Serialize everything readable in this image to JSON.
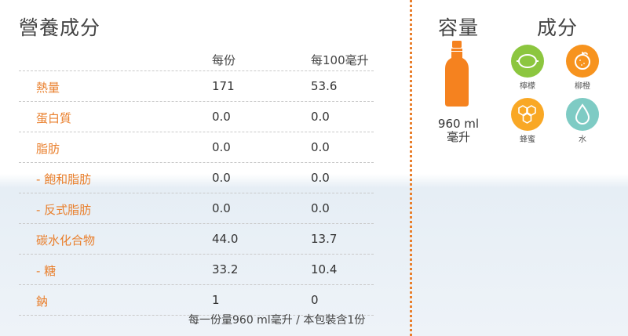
{
  "nutrition": {
    "title": "營養成分",
    "headers": [
      "每份",
      "每100毫升"
    ],
    "rows": [
      {
        "label": "熱量",
        "per_serving": "171",
        "per_100ml": "53.6"
      },
      {
        "label": "蛋白質",
        "per_serving": "0.0",
        "per_100ml": "0.0"
      },
      {
        "label": "脂肪",
        "per_serving": "0.0",
        "per_100ml": "0.0"
      },
      {
        "label": "- 飽和脂肪",
        "per_serving": "0.0",
        "per_100ml": "0.0"
      },
      {
        "label": "- 反式脂肪",
        "per_serving": "0.0",
        "per_100ml": "0.0"
      },
      {
        "label": "碳水化合物",
        "per_serving": "44.0",
        "per_100ml": "13.7"
      },
      {
        "label": "- 糖",
        "per_serving": "33.2",
        "per_100ml": "10.4"
      },
      {
        "label": "鈉",
        "per_serving": "1",
        "per_100ml": "0"
      }
    ],
    "footnote": "每一份量960 ml毫升 / 本包裝含1份"
  },
  "volume": {
    "title": "容量",
    "line1": "960 ml",
    "line2": "毫升"
  },
  "ingredients": {
    "title": "成分",
    "items": [
      {
        "label": "檸檬",
        "icon": "lemon-icon",
        "color": "#8cc63f"
      },
      {
        "label": "柳橙",
        "icon": "orange-icon",
        "color": "#f7931e"
      },
      {
        "label": "蜂蜜",
        "icon": "honeycomb-icon",
        "color": "#f9a825"
      },
      {
        "label": "水",
        "icon": "water-drop-icon",
        "color": "#7ecbc4"
      }
    ]
  },
  "colors": {
    "accent": "#e97f2c",
    "bottle": "#f5821f"
  }
}
